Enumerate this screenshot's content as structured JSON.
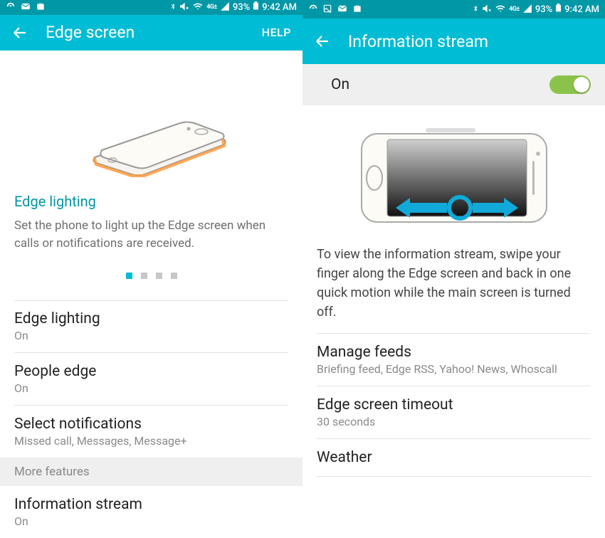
{
  "shared": {
    "battery_pct": "93%",
    "time": "9:42 AM"
  },
  "left": {
    "app_title": "Edge screen",
    "help_label": "HELP",
    "hero": {
      "title": "Edge lighting",
      "desc": "Set the phone to light up the Edge screen when calls or notifications are received."
    },
    "items": [
      {
        "title": "Edge lighting",
        "sub": "On"
      },
      {
        "title": "People edge",
        "sub": "On"
      },
      {
        "title": "Select notifications",
        "sub": "Missed call, Messages, Message+"
      }
    ],
    "section_header": "More features",
    "item_infostream": {
      "title": "Information stream",
      "sub": "On"
    }
  },
  "right": {
    "app_title": "Information stream",
    "toggle": {
      "label": "On",
      "switch_text": "ON"
    },
    "hero_desc": "To view the information stream, swipe your finger along the Edge screen and back in one quick motion while the main screen is turned off.",
    "items": [
      {
        "title": "Manage feeds",
        "sub": "Briefing feed, Edge RSS, Yahoo! News, Whoscall"
      },
      {
        "title": "Edge screen timeout",
        "sub": "30 seconds"
      },
      {
        "title": "Weather",
        "sub": ""
      }
    ]
  }
}
